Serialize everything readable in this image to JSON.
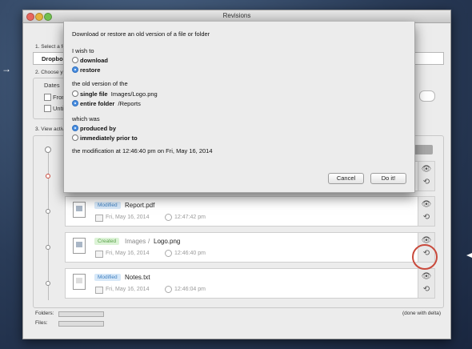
{
  "window": {
    "title": "Revisions"
  },
  "steps": {
    "step1": "1. Select a fo",
    "source_value": "Dropbo",
    "step2": "2. Choose yo",
    "dates_label": "Dates",
    "from_label": "From",
    "until_label": "Until",
    "step3": "3. View activ"
  },
  "dialog": {
    "title": "Download or restore an old version of a file or folder",
    "wish_label": "I wish to",
    "opt_download": "download",
    "opt_restore": "restore",
    "version_label": "the old version of the",
    "opt_single_file": "single file",
    "single_file_path": "Images/Logo.png",
    "opt_entire_folder": "entire folder",
    "entire_folder_path": "/Reports",
    "which_label": "which was",
    "opt_produced_by": "produced by",
    "opt_prior_to": "immediately prior to",
    "modification_text": "the modification at 12:46:40 pm on Fri, May 16, 2014",
    "cancel_label": "Cancel",
    "doit_label": "Do it!"
  },
  "revisions": [
    {
      "badge": "Modified",
      "folder": "",
      "name": "Report.pdf",
      "date": "Fri, May 16, 2014",
      "time": "12:47:42 pm"
    },
    {
      "badge": "Created",
      "folder": "Images",
      "name": "Logo.png",
      "date": "Fri, May 16, 2014",
      "time": "12:46:40 pm"
    },
    {
      "badge": "Modified",
      "folder": "",
      "name": "Notes.txt",
      "date": "Fri, May 16, 2014",
      "time": "12:46:04 pm"
    }
  ],
  "footer": {
    "folders_label": "Folders:",
    "files_label": "Files:",
    "status": "(done with delta)"
  },
  "colors": {
    "badge_modified": "#3f7fbf",
    "badge_created": "#5aa24a",
    "highlight_ring": "#c94a3c",
    "radio_selected": "#4b8fe0"
  },
  "icons": {
    "eye": "👁",
    "restore": "⟲"
  }
}
